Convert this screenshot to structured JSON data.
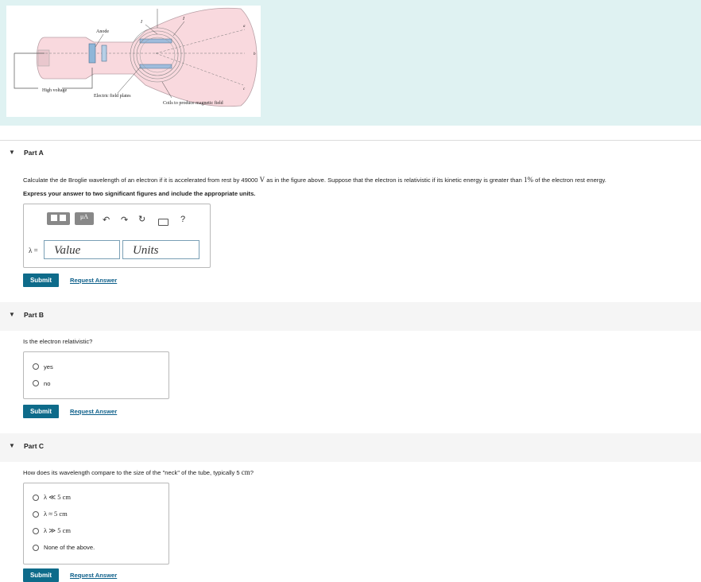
{
  "figure": {
    "labels": {
      "anode": "Anode",
      "high_voltage": "High voltage",
      "electric_field_plates": "Electric field plates",
      "coils": "Coils to produce magnetic field",
      "a": "a",
      "b": "b",
      "c": "c",
      "I1": "I",
      "I2": "I"
    }
  },
  "partA": {
    "title": "Part A",
    "question_pre": "Calculate the de Broglie wavelength of an electron if it is accelerated from rest by 49000",
    "voltage_unit": "V",
    "question_mid": "as in the figure above. Suppose that the electron is relativistic if its kinetic energy is greater than",
    "percent": "1%",
    "question_post": "of the electron rest energy.",
    "instruction": "Express your answer to two significant figures and include the appropriate units.",
    "toolbar": {
      "mu_label": "μA",
      "help": "?"
    },
    "answer_label": "λ =",
    "value_placeholder": "Value",
    "units_placeholder": "Units",
    "submit": "Submit",
    "request": "Request Answer"
  },
  "partB": {
    "title": "Part B",
    "question": "Is the electron relativistic?",
    "options": [
      "yes",
      "no"
    ],
    "submit": "Submit",
    "request": "Request Answer"
  },
  "partC": {
    "title": "Part C",
    "question_pre": "How does its wavelength compare to the size of the \"neck\" of the tube, typically 5",
    "question_unit": "cm",
    "question_post": "?",
    "options": [
      "λ ≪ 5 cm",
      "λ ≈ 5 cm",
      "λ ≫ 5 cm",
      "None of the above."
    ],
    "submit": "Submit",
    "request": "Request Answer"
  }
}
